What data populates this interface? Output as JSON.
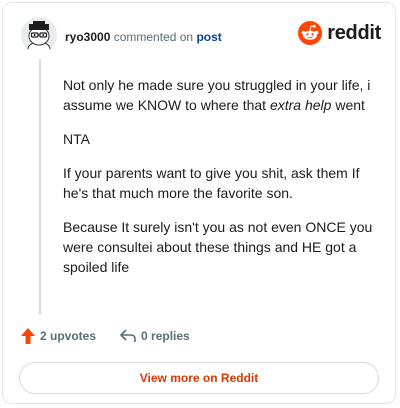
{
  "header": {
    "username": "ryo3000",
    "action_text": "commented on",
    "post_link": "post",
    "brand": "reddit"
  },
  "comment": {
    "paragraphs": [
      {
        "before": "Not only he made sure you struggled in your life, i assume we KNOW to where that ",
        "italic": "extra help",
        "after": " went"
      },
      {
        "before": "NTA",
        "italic": "",
        "after": ""
      },
      {
        "before": "If your parents want to give you shit, ask them If he's that much more the favorite son.",
        "italic": "",
        "after": ""
      },
      {
        "before": "Because It surely isn't you as not even ONCE you were consultei about these things and HE got a spoiled life",
        "italic": "",
        "after": ""
      }
    ]
  },
  "actions": {
    "upvotes": "2 upvotes",
    "replies": "0 replies"
  },
  "footer": {
    "view_more": "View more on Reddit"
  },
  "colors": {
    "brand_orange": "#ff4500",
    "link_blue": "#0a449b",
    "view_more_text": "#d93a00"
  },
  "icons": [
    "avatar-icon",
    "reddit-logo-icon",
    "upvote-arrow-icon",
    "reply-arrow-icon"
  ]
}
